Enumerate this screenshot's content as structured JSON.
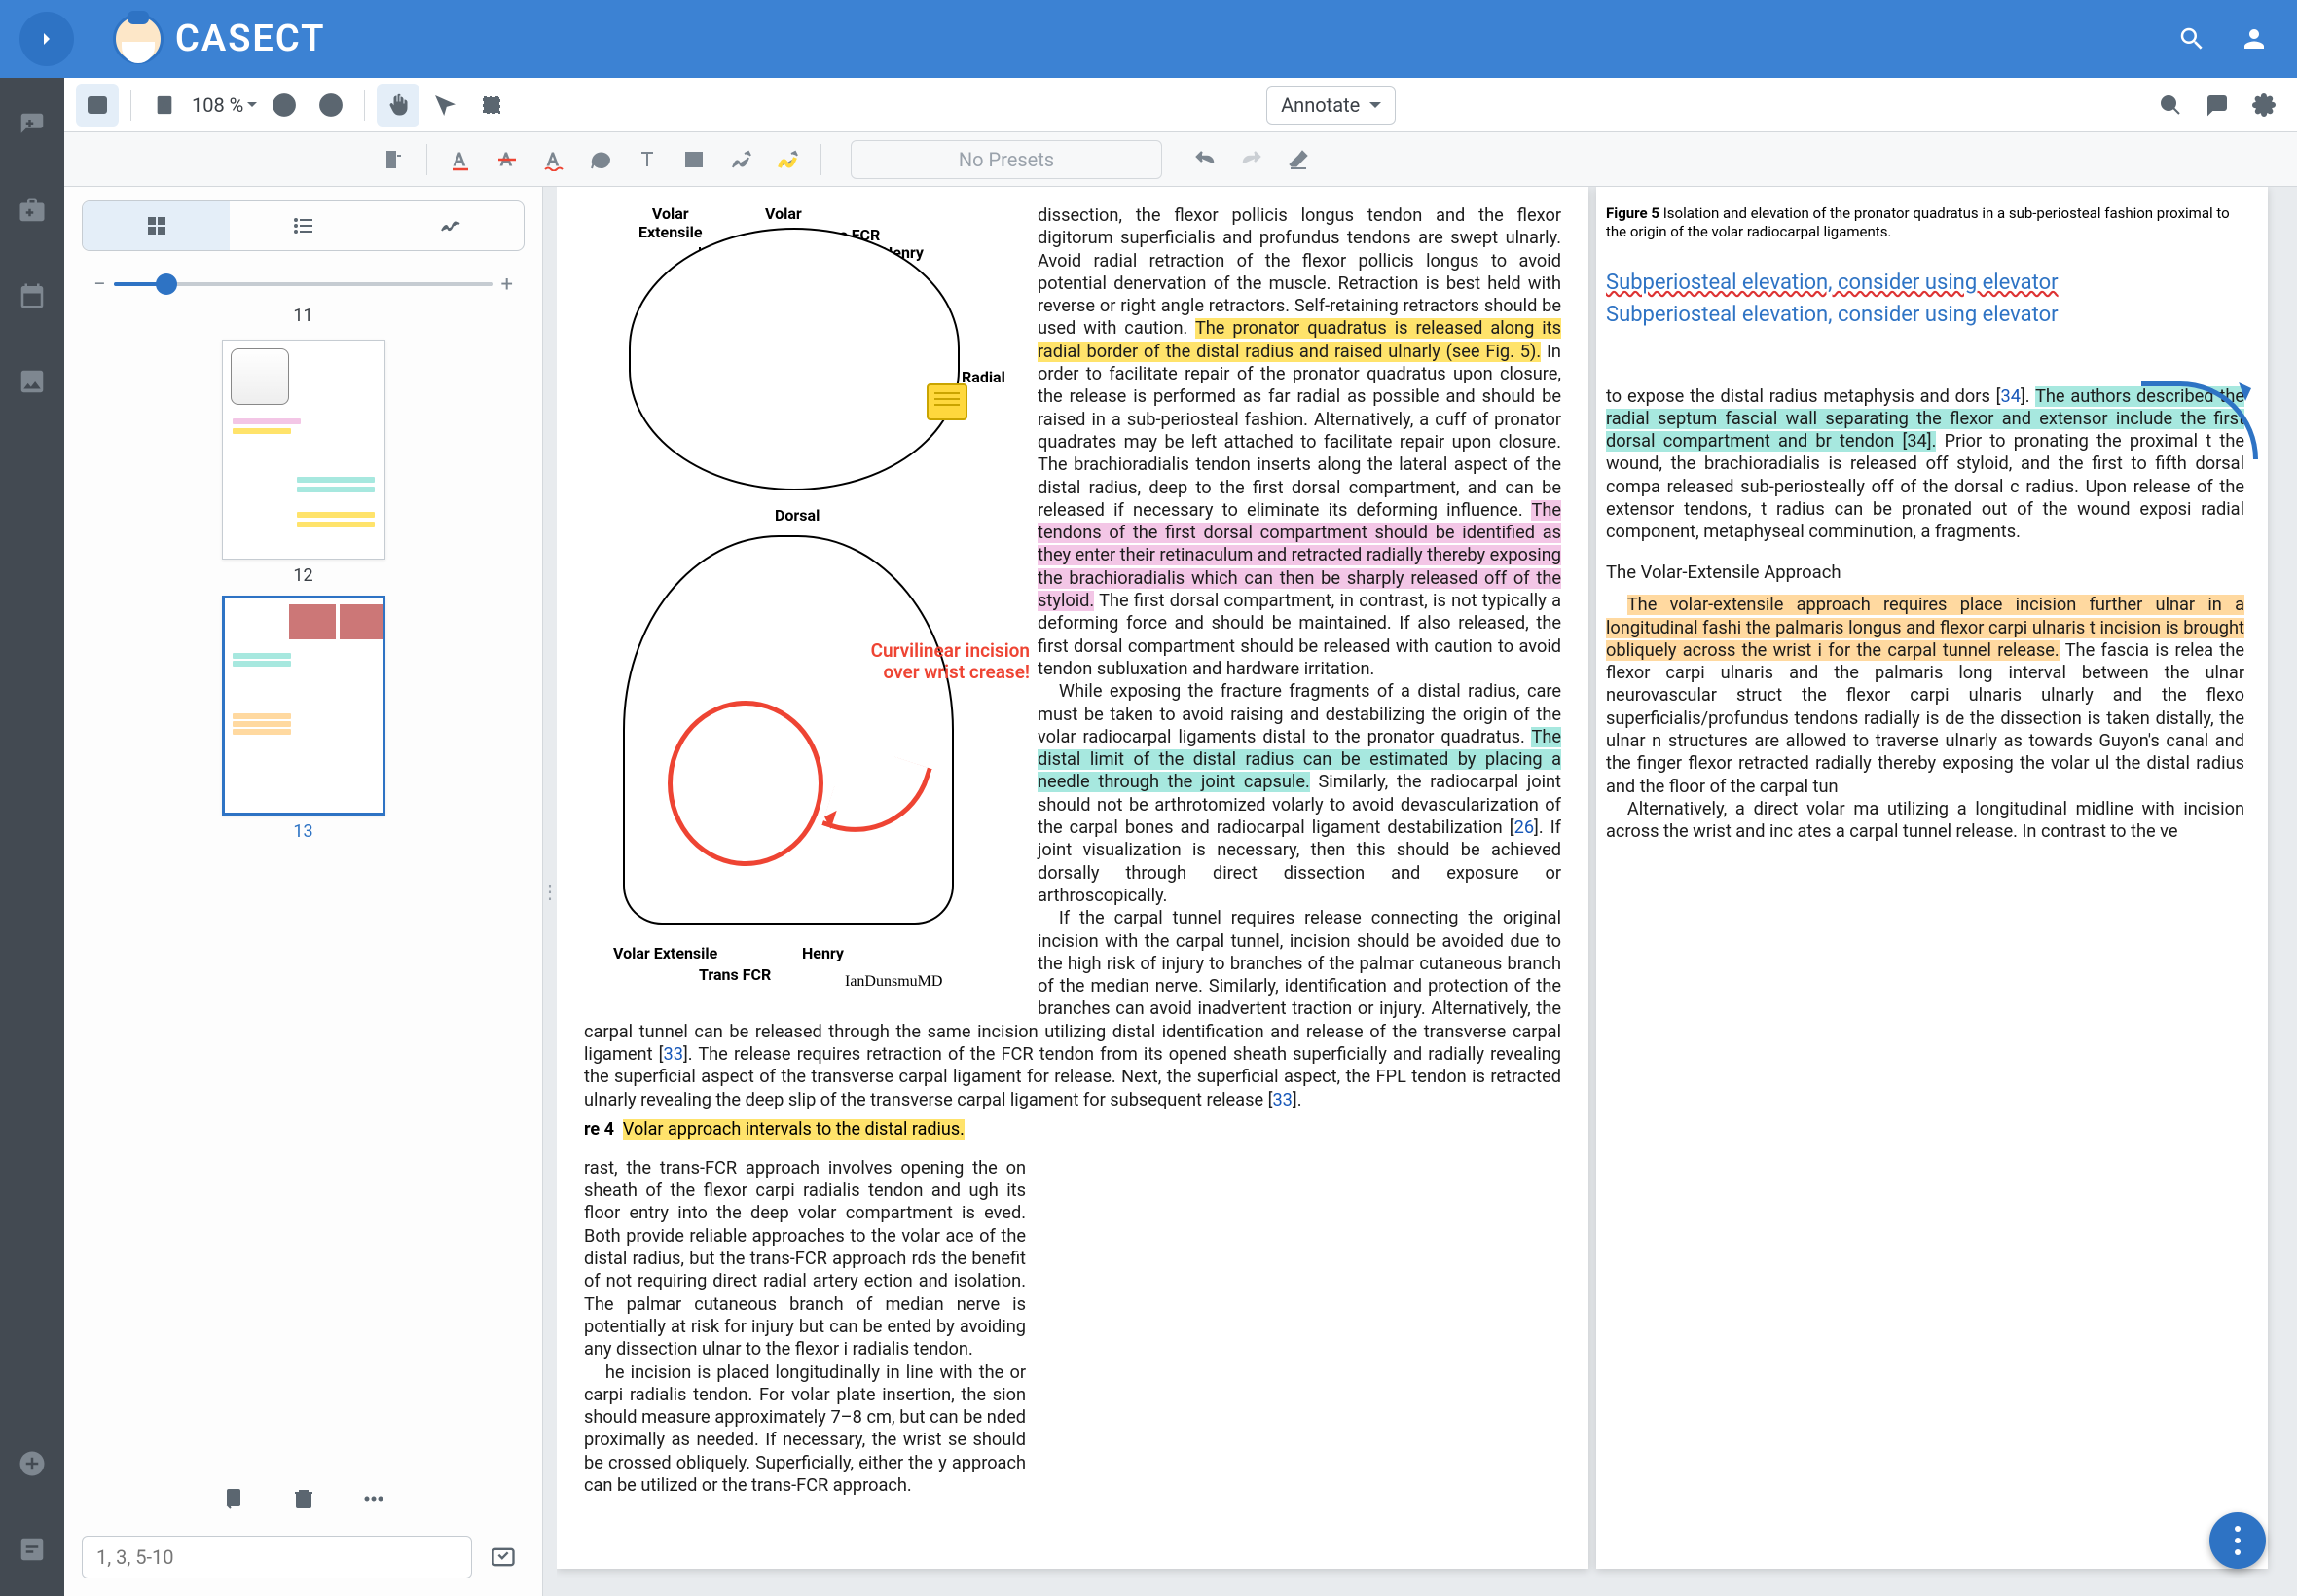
{
  "app": {
    "title": "CASECT"
  },
  "toolbar": {
    "zoom": "108 %",
    "annotate_label": "Annotate",
    "presets_placeholder": "No Presets"
  },
  "thumbs": {
    "top_partial_label": "11",
    "pages": [
      {
        "num": "12",
        "selected": false
      },
      {
        "num": "13",
        "selected": true
      }
    ],
    "page_input_placeholder": "1, 3, 5-10"
  },
  "doc": {
    "anat_labels": {
      "volar": "Volar",
      "volar_ext": "Volar\nExtensile",
      "trans_fcr": "Trans FCR",
      "henry": "Henry",
      "radial": "Radial",
      "dorsal": "Dorsal",
      "volar_ext2": "Volar Extensile",
      "henry2": "Henry",
      "trans_fcr2": "Trans FCR",
      "signature": "IanDunsmuMD"
    },
    "red_annotation": "Curvilinear incision over wrist crease!",
    "fig4_label": "re 4",
    "fig4_caption": "Volar approach intervals to the distal radius.",
    "left_col_para1": "rast, the trans-FCR approach involves opening the on sheath of the flexor carpi radialis tendon and ugh its floor entry into the deep volar compartment is eved. Both provide reliable approaches to the volar ace of the distal radius, but the trans-FCR approach rds the benefit of not requiring direct radial artery ection and isolation. The palmar cutaneous branch of median nerve is potentially at risk for injury but can be ented by avoiding any dissection ulnar to the flexor i radialis tendon.",
    "left_col_para2": "he incision is placed longitudinally in line with the or carpi radialis tendon. For volar plate insertion, the sion should measure approximately 7–8 cm, but can be nded proximally as needed. If necessary, the wrist se should be crossed obliquely. Superficially, either the y approach can be utilized or the trans-FCR approach.",
    "right_col_para1_a": "dissection, the flexor pollicis longus tendon and the flexor digitorum superficialis and profundus tendons are swept ulnarly. Avoid radial retraction of the flexor pollicis longus to avoid potential denervation of the muscle. Retraction is best held with reverse or right angle retractors. Self-retaining retractors should be used with caution. ",
    "right_col_para1_hl_y": "The pronator quadratus is released along its radial border of the distal radius and raised ulnarly (see Fig. 5).",
    "right_col_para1_b": " In order to facilitate repair of the pronator quadratus upon closure, the release is performed as far radial as possible and should be raised in a sub-periosteal fashion. Alternatively, a cuff of pronator quadrates may be left attached to facilitate repair upon closure. The brachioradialis tendon inserts along the lateral aspect of the distal radius, deep to the first dorsal compartment, and can be released if necessary to eliminate its deforming influence. ",
    "right_col_para1_hl_p": "The tendons of the first dorsal compartment should be identified as they enter their retinaculum and retracted radially thereby exposing the brachioradialis which can then be sharply released off of the styloid.",
    "right_col_para1_c": " The first dorsal compartment, in contrast, is not typically a deforming force and should be maintained. If also released, the first dorsal compartment should be released with caution to avoid tendon subluxation and hardware irritation.",
    "right_col_para2_a": "While exposing the fracture fragments of a distal radius, care must be taken to avoid raising and destabilizing the origin of the volar radiocarpal ligaments distal to the pronator quadratus. ",
    "right_col_para2_hl_c": "The distal limit of the distal radius can be estimated by placing a needle through the joint capsule.",
    "right_col_para2_b": " Similarly, the radiocarpal joint should not be arthrotomized volarly to avoid devascularization of the carpal bones and radiocarpal ligament destabilization [",
    "right_col_para2_ref": "26",
    "right_col_para2_c": "]. If joint visualization is necessary, then this should be achieved dorsally through direct dissection and exposure or arthroscopically.",
    "right_col_para3_a": "If the carpal tunnel requires release connecting the original incision with the carpal tunnel, incision should be avoided due to the high risk of injury to branches of the palmar cutaneous branch of the median nerve. Similarly, identification and protection of the branches can avoid inadvertent traction or injury. Alternatively, the carpal tunnel can be released through the same incision utilizing distal identification and release of the transverse carpal ligament [",
    "right_col_para3_ref1": "33",
    "right_col_para3_b": "]. The release requires retraction of the FCR tendon from its opened sheath superficially and radially revealing the superficial aspect of the transverse carpal ligament for release. Next, the superficial aspect, the FPL tendon is retracted ulnarly revealing the deep slip of the transverse carpal ligament for subsequent release [",
    "right_col_para3_ref2": "33",
    "right_col_para3_c": "].",
    "page_right": {
      "fig5_label": "Figure 5",
      "fig5_caption": "Isolation and elevation of the pronator quadratus in a sub-periosteal fashion proximal to the origin of the volar radiocarpal ligaments.",
      "note1": "Subperiosteal elevation, consider using elevator",
      "note2": "Subperiosteal elevation, consider using elevator",
      "para1_a": "to expose the distal radius metaphysis and dors [",
      "para1_ref": "34",
      "para1_b": "]. ",
      "para1_hl_c": "The authors described the radial septum fascial wall separating the flexor and extensor include the first dorsal compartment and br tendon [34].",
      "para1_c": " Prior to pronating the proximal t the wound, the brachioradialis is released off styloid, and the first to fifth dorsal compa released sub-periosteally off of the dorsal c radius. Upon release of the extensor tendons, t radius can be pronated out of the wound exposi radial component, metaphyseal comminution, a fragments.",
      "section": "The Volar-Extensile Approach",
      "para2_hl_o": "The volar-extensile approach requires place incision further ulnar in a longitudinal fashi the palmaris longus and flexor carpi ulnaris t incision is brought obliquely across the wrist i for the carpal tunnel release.",
      "para2_b": " The fascia is relea the flexor carpi ulnaris and the palmaris long interval between the ulnar neurovascular struct the flexor carpi ulnaris ulnarly and the flexo superficialis/profundus tendons radially is de the dissection is taken distally, the ulnar n structures are allowed to traverse ulnarly as towards Guyon's canal and the finger flexor retracted radially thereby exposing the volar ul the distal radius and the floor of the carpal tun",
      "para3": "Alternatively, a direct volar               ma utilizing a longitudinal midline              with incision across the wrist and inc           ates a carpal tunnel release. In contrast to the ve"
    }
  }
}
